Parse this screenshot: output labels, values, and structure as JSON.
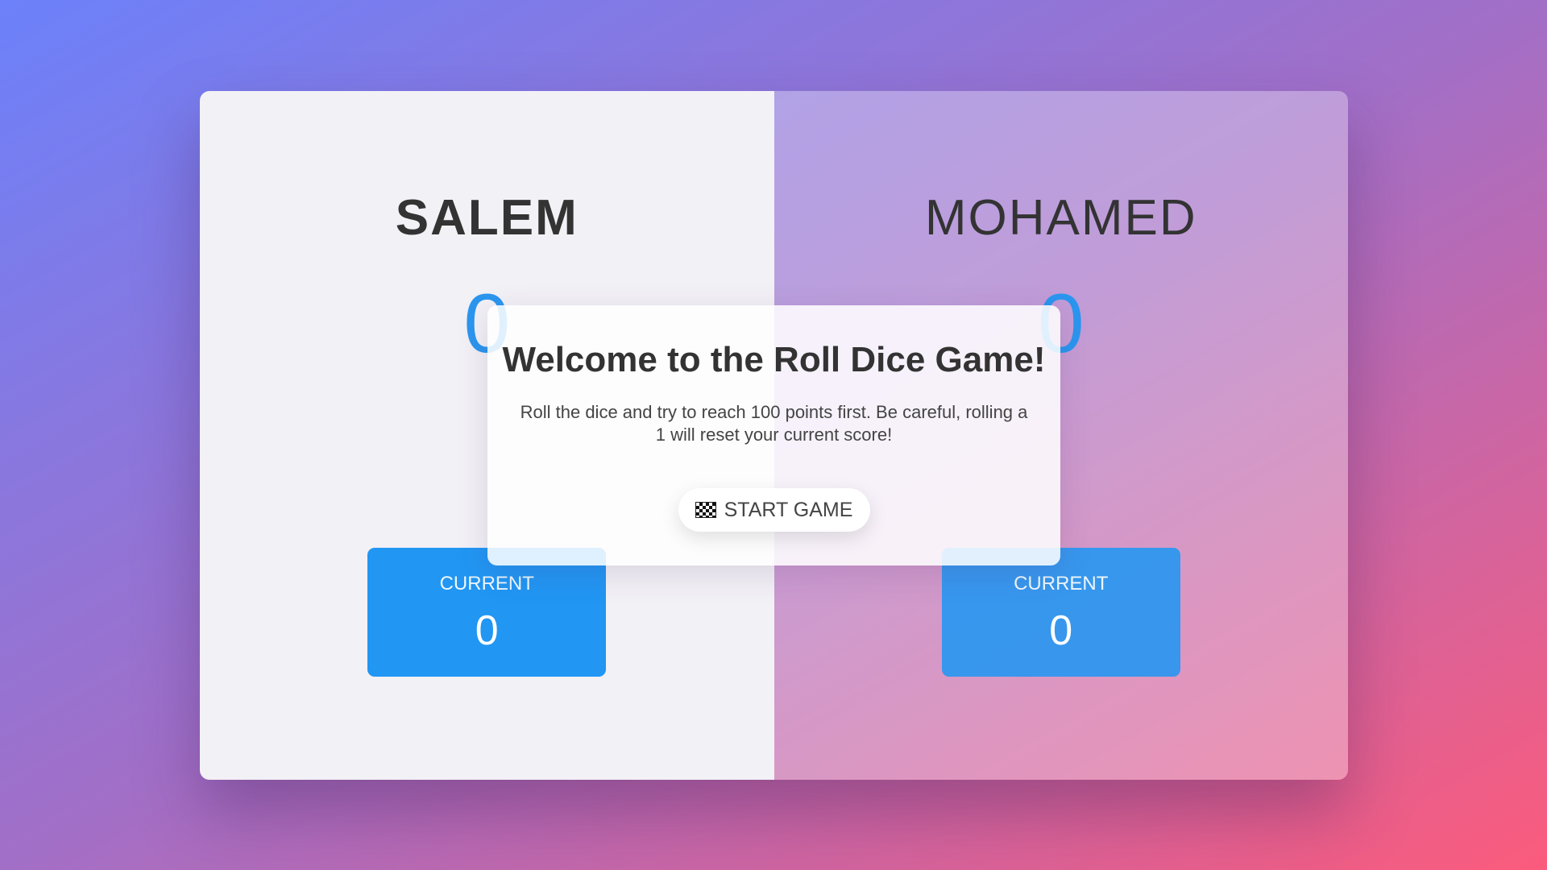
{
  "players": [
    {
      "name": "SALEM",
      "score": "0",
      "current_label": "CURRENT",
      "current_score": "0",
      "active": true
    },
    {
      "name": "MOHAMED",
      "score": "0",
      "current_label": "CURRENT",
      "current_score": "0",
      "active": false
    }
  ],
  "overlay": {
    "title": "Welcome to the Roll Dice Game!",
    "text": "Roll the dice and try to reach 100 points first. Be careful, rolling a 1 will reset your current score!",
    "start_button_label": "START GAME",
    "start_button_icon": "checkered-flag-icon"
  },
  "colors": {
    "accent": "#2196f3",
    "background_start": "#6c81fa",
    "background_end": "#fb5b7c"
  }
}
